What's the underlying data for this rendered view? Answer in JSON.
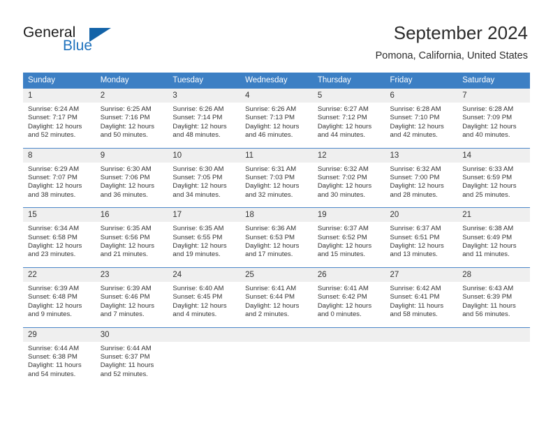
{
  "brand": {
    "word_one": "General",
    "word_two": "Blue",
    "triangle_icon": "triangle-logo-icon",
    "accent_color": "#1363a8",
    "blue_text_color": "#1f72bd"
  },
  "header": {
    "title": "September 2024",
    "subtitle": "Pomona, California, United States"
  },
  "calendar": {
    "header_bg": "#3c7fc4",
    "header_text_color": "#ffffff",
    "daynum_bg": "#efefef",
    "row_divider_color": "#4a86c8",
    "weekdays": [
      "Sunday",
      "Monday",
      "Tuesday",
      "Wednesday",
      "Thursday",
      "Friday",
      "Saturday"
    ],
    "weeks": [
      [
        {
          "day": "1",
          "sunrise": "Sunrise: 6:24 AM",
          "sunset": "Sunset: 7:17 PM",
          "daylight_line1": "Daylight: 12 hours",
          "daylight_line2": "and 52 minutes."
        },
        {
          "day": "2",
          "sunrise": "Sunrise: 6:25 AM",
          "sunset": "Sunset: 7:16 PM",
          "daylight_line1": "Daylight: 12 hours",
          "daylight_line2": "and 50 minutes."
        },
        {
          "day": "3",
          "sunrise": "Sunrise: 6:26 AM",
          "sunset": "Sunset: 7:14 PM",
          "daylight_line1": "Daylight: 12 hours",
          "daylight_line2": "and 48 minutes."
        },
        {
          "day": "4",
          "sunrise": "Sunrise: 6:26 AM",
          "sunset": "Sunset: 7:13 PM",
          "daylight_line1": "Daylight: 12 hours",
          "daylight_line2": "and 46 minutes."
        },
        {
          "day": "5",
          "sunrise": "Sunrise: 6:27 AM",
          "sunset": "Sunset: 7:12 PM",
          "daylight_line1": "Daylight: 12 hours",
          "daylight_line2": "and 44 minutes."
        },
        {
          "day": "6",
          "sunrise": "Sunrise: 6:28 AM",
          "sunset": "Sunset: 7:10 PM",
          "daylight_line1": "Daylight: 12 hours",
          "daylight_line2": "and 42 minutes."
        },
        {
          "day": "7",
          "sunrise": "Sunrise: 6:28 AM",
          "sunset": "Sunset: 7:09 PM",
          "daylight_line1": "Daylight: 12 hours",
          "daylight_line2": "and 40 minutes."
        }
      ],
      [
        {
          "day": "8",
          "sunrise": "Sunrise: 6:29 AM",
          "sunset": "Sunset: 7:07 PM",
          "daylight_line1": "Daylight: 12 hours",
          "daylight_line2": "and 38 minutes."
        },
        {
          "day": "9",
          "sunrise": "Sunrise: 6:30 AM",
          "sunset": "Sunset: 7:06 PM",
          "daylight_line1": "Daylight: 12 hours",
          "daylight_line2": "and 36 minutes."
        },
        {
          "day": "10",
          "sunrise": "Sunrise: 6:30 AM",
          "sunset": "Sunset: 7:05 PM",
          "daylight_line1": "Daylight: 12 hours",
          "daylight_line2": "and 34 minutes."
        },
        {
          "day": "11",
          "sunrise": "Sunrise: 6:31 AM",
          "sunset": "Sunset: 7:03 PM",
          "daylight_line1": "Daylight: 12 hours",
          "daylight_line2": "and 32 minutes."
        },
        {
          "day": "12",
          "sunrise": "Sunrise: 6:32 AM",
          "sunset": "Sunset: 7:02 PM",
          "daylight_line1": "Daylight: 12 hours",
          "daylight_line2": "and 30 minutes."
        },
        {
          "day": "13",
          "sunrise": "Sunrise: 6:32 AM",
          "sunset": "Sunset: 7:00 PM",
          "daylight_line1": "Daylight: 12 hours",
          "daylight_line2": "and 28 minutes."
        },
        {
          "day": "14",
          "sunrise": "Sunrise: 6:33 AM",
          "sunset": "Sunset: 6:59 PM",
          "daylight_line1": "Daylight: 12 hours",
          "daylight_line2": "and 25 minutes."
        }
      ],
      [
        {
          "day": "15",
          "sunrise": "Sunrise: 6:34 AM",
          "sunset": "Sunset: 6:58 PM",
          "daylight_line1": "Daylight: 12 hours",
          "daylight_line2": "and 23 minutes."
        },
        {
          "day": "16",
          "sunrise": "Sunrise: 6:35 AM",
          "sunset": "Sunset: 6:56 PM",
          "daylight_line1": "Daylight: 12 hours",
          "daylight_line2": "and 21 minutes."
        },
        {
          "day": "17",
          "sunrise": "Sunrise: 6:35 AM",
          "sunset": "Sunset: 6:55 PM",
          "daylight_line1": "Daylight: 12 hours",
          "daylight_line2": "and 19 minutes."
        },
        {
          "day": "18",
          "sunrise": "Sunrise: 6:36 AM",
          "sunset": "Sunset: 6:53 PM",
          "daylight_line1": "Daylight: 12 hours",
          "daylight_line2": "and 17 minutes."
        },
        {
          "day": "19",
          "sunrise": "Sunrise: 6:37 AM",
          "sunset": "Sunset: 6:52 PM",
          "daylight_line1": "Daylight: 12 hours",
          "daylight_line2": "and 15 minutes."
        },
        {
          "day": "20",
          "sunrise": "Sunrise: 6:37 AM",
          "sunset": "Sunset: 6:51 PM",
          "daylight_line1": "Daylight: 12 hours",
          "daylight_line2": "and 13 minutes."
        },
        {
          "day": "21",
          "sunrise": "Sunrise: 6:38 AM",
          "sunset": "Sunset: 6:49 PM",
          "daylight_line1": "Daylight: 12 hours",
          "daylight_line2": "and 11 minutes."
        }
      ],
      [
        {
          "day": "22",
          "sunrise": "Sunrise: 6:39 AM",
          "sunset": "Sunset: 6:48 PM",
          "daylight_line1": "Daylight: 12 hours",
          "daylight_line2": "and 9 minutes."
        },
        {
          "day": "23",
          "sunrise": "Sunrise: 6:39 AM",
          "sunset": "Sunset: 6:46 PM",
          "daylight_line1": "Daylight: 12 hours",
          "daylight_line2": "and 7 minutes."
        },
        {
          "day": "24",
          "sunrise": "Sunrise: 6:40 AM",
          "sunset": "Sunset: 6:45 PM",
          "daylight_line1": "Daylight: 12 hours",
          "daylight_line2": "and 4 minutes."
        },
        {
          "day": "25",
          "sunrise": "Sunrise: 6:41 AM",
          "sunset": "Sunset: 6:44 PM",
          "daylight_line1": "Daylight: 12 hours",
          "daylight_line2": "and 2 minutes."
        },
        {
          "day": "26",
          "sunrise": "Sunrise: 6:41 AM",
          "sunset": "Sunset: 6:42 PM",
          "daylight_line1": "Daylight: 12 hours",
          "daylight_line2": "and 0 minutes."
        },
        {
          "day": "27",
          "sunrise": "Sunrise: 6:42 AM",
          "sunset": "Sunset: 6:41 PM",
          "daylight_line1": "Daylight: 11 hours",
          "daylight_line2": "and 58 minutes."
        },
        {
          "day": "28",
          "sunrise": "Sunrise: 6:43 AM",
          "sunset": "Sunset: 6:39 PM",
          "daylight_line1": "Daylight: 11 hours",
          "daylight_line2": "and 56 minutes."
        }
      ],
      [
        {
          "day": "29",
          "sunrise": "Sunrise: 6:44 AM",
          "sunset": "Sunset: 6:38 PM",
          "daylight_line1": "Daylight: 11 hours",
          "daylight_line2": "and 54 minutes."
        },
        {
          "day": "30",
          "sunrise": "Sunrise: 6:44 AM",
          "sunset": "Sunset: 6:37 PM",
          "daylight_line1": "Daylight: 11 hours",
          "daylight_line2": "and 52 minutes."
        },
        {
          "day": "",
          "sunrise": "",
          "sunset": "",
          "daylight_line1": "",
          "daylight_line2": ""
        },
        {
          "day": "",
          "sunrise": "",
          "sunset": "",
          "daylight_line1": "",
          "daylight_line2": ""
        },
        {
          "day": "",
          "sunrise": "",
          "sunset": "",
          "daylight_line1": "",
          "daylight_line2": ""
        },
        {
          "day": "",
          "sunrise": "",
          "sunset": "",
          "daylight_line1": "",
          "daylight_line2": ""
        },
        {
          "day": "",
          "sunrise": "",
          "sunset": "",
          "daylight_line1": "",
          "daylight_line2": ""
        }
      ]
    ]
  }
}
